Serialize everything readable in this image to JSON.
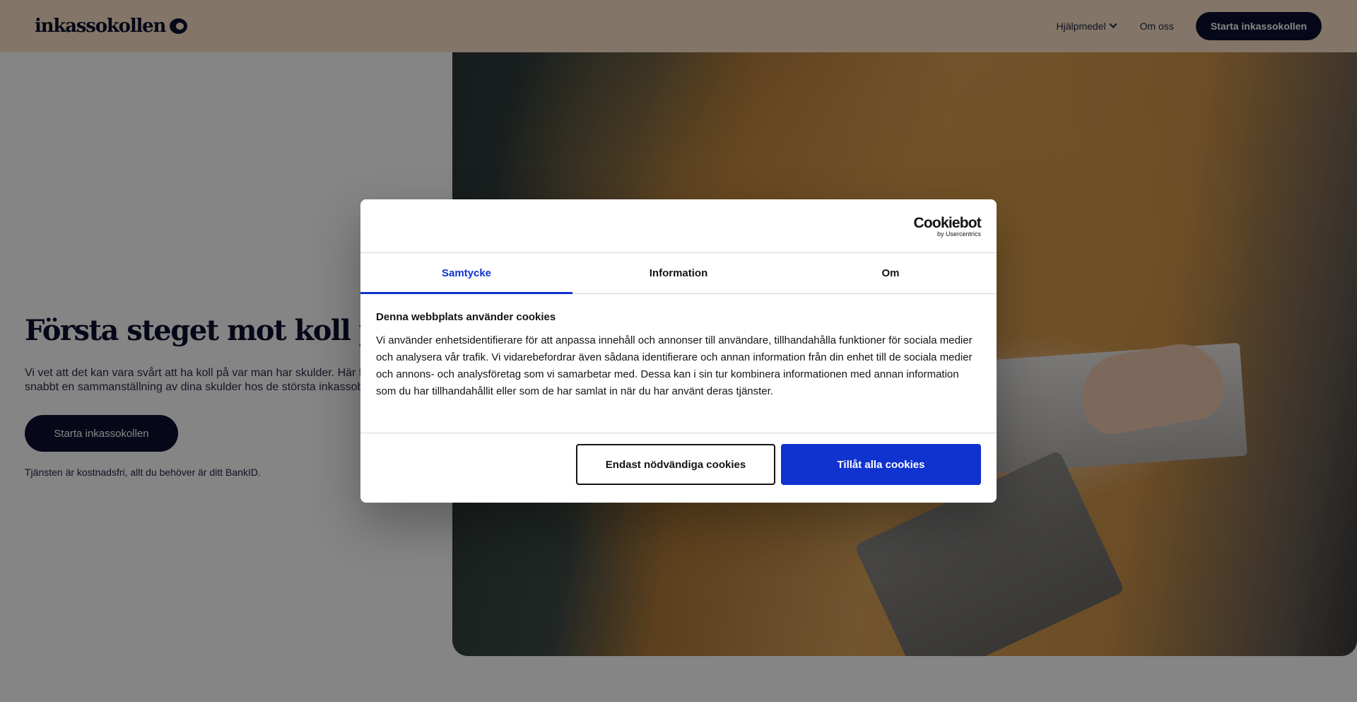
{
  "header": {
    "logo": "inkassokollen",
    "nav": {
      "tools_label": "Hjälpmedel",
      "about_label": "Om oss",
      "cta_label": "Starta inkassokollen"
    }
  },
  "hero": {
    "title": "Första steget mot koll på läget",
    "description_line1": "Vi vet att det kan vara svårt att ha koll på var man har skulder. Här får du",
    "description_line2": "snabbt en sammanställning av dina skulder hos de största inkassobolagen.",
    "cta_label": "Starta inkassokollen",
    "note": "Tjänsten är kostnadsfri, allt du behöver är ditt BankID."
  },
  "cookie_dialog": {
    "brand": "Cookiebot",
    "brand_sub": "by Usercentrics",
    "tabs": [
      "Samtycke",
      "Information",
      "Om"
    ],
    "active_tab": "Samtycke",
    "heading": "Denna webbplats använder cookies",
    "body": "Vi använder enhetsidentifierare för att anpassa innehåll och annonser till användare, tillhandahålla funktioner för sociala medier och analysera vår trafik. Vi vidarebefordrar även sådana identifierare och annan information från din enhet till de sociala medier och annons- och analysföretag som vi samarbetar med. Dessa kan i sin tur kombinera informationen med annan information som du har tillhandahållit eller som de har samlat in när du har använt deras tjänster.",
    "necessary_label": "Endast nödvändiga cookies",
    "allow_all_label": "Tillåt alla cookies",
    "accent_color": "#1032cf"
  }
}
